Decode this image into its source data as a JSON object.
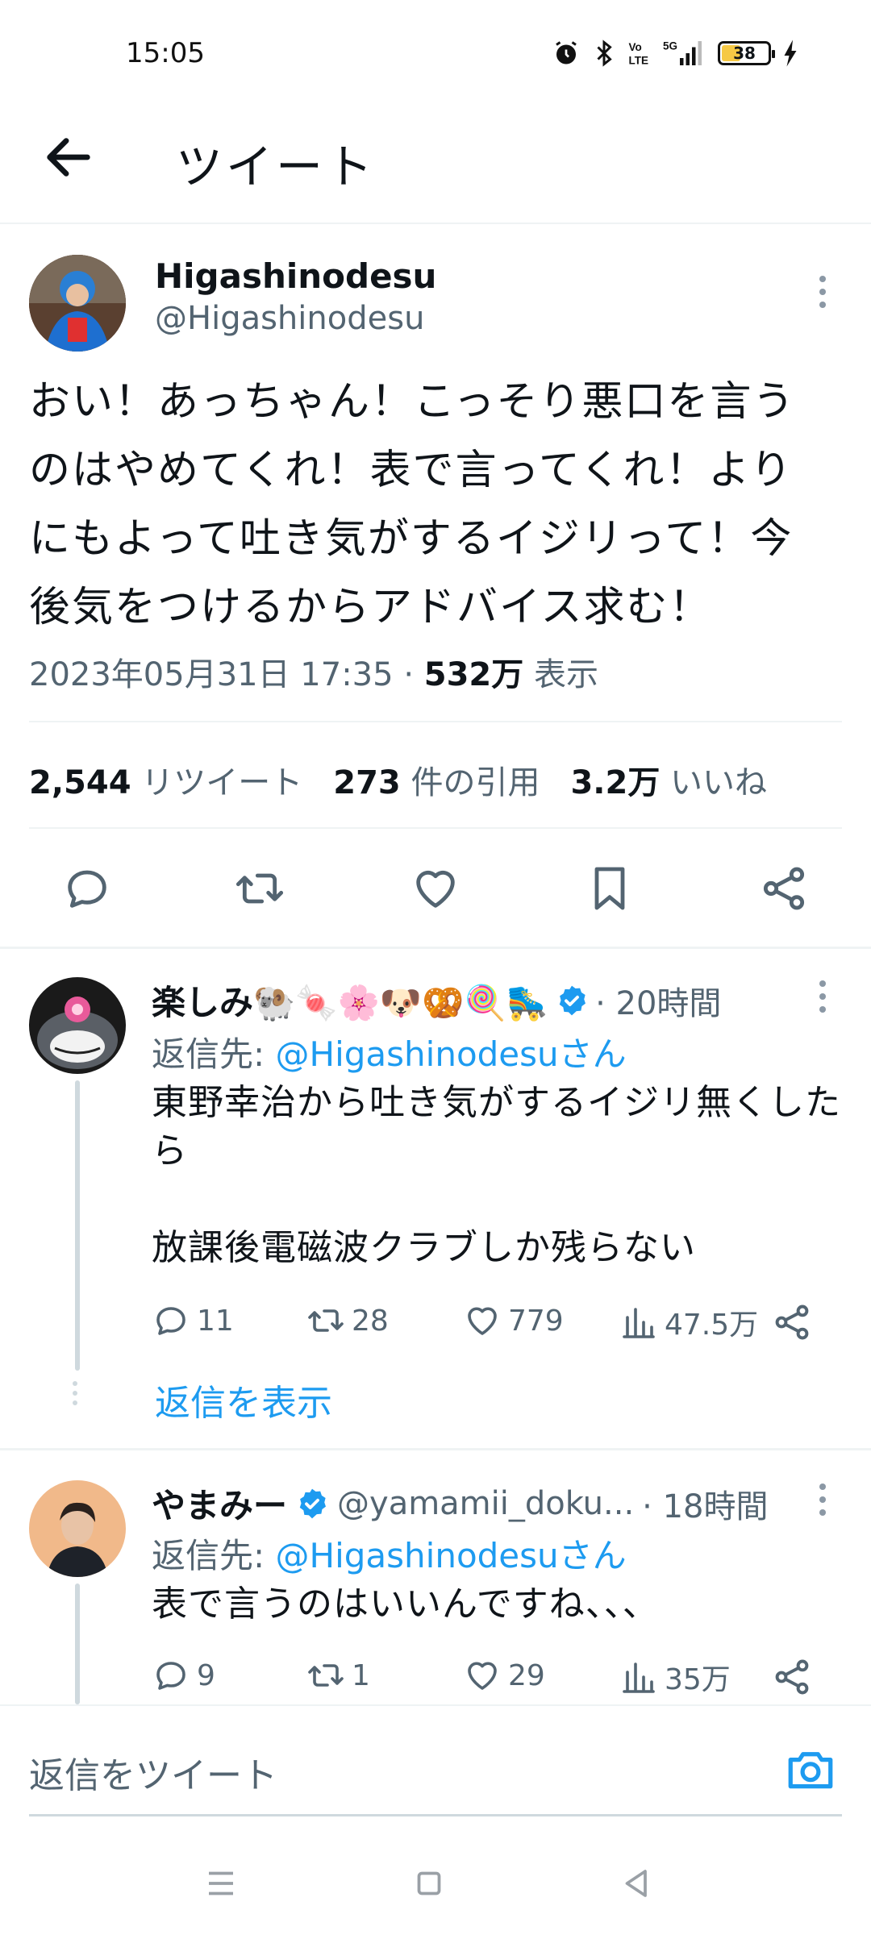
{
  "status_bar": {
    "time": "15:05",
    "battery": "38",
    "network": "5G",
    "icons": [
      "alarm-icon",
      "bluetooth-icon",
      "volte-icon",
      "signal-icon",
      "battery-icon",
      "charging-icon"
    ]
  },
  "header": {
    "title": "ツイート",
    "back_icon": "arrow-left-icon"
  },
  "tweet": {
    "author_name": "Higashinodesu",
    "author_handle": "@Higashinodesu",
    "text": "おい！あっちゃん！こっそり悪口を言う\nのはやめてくれ！表で言ってくれ！より\nにもよって吐き気がするイジリって！今\n後気をつけるからアドバイス求む！",
    "timestamp": "2023年05月31日 17:35",
    "separator": "·",
    "views_count": "532万",
    "views_label": "表示",
    "retweets_count": "2,544",
    "retweets_label": "リツイート",
    "quotes_count": "273",
    "quotes_label": "件の引用",
    "likes_count": "3.2万",
    "likes_label": "いいね"
  },
  "replies": [
    {
      "name": "楽しみ🐏🍬🌸🐶🥨🍭🛼",
      "verified": true,
      "time": "· 20時間",
      "reply_to_prefix": "返信先:",
      "reply_to_handle": "@Higashinodesuさん",
      "text": "東野幸治から吐き気がするイジリ無くした\nら\n\n放課後電磁波クラブしか残らない",
      "replies": "11",
      "retweets": "28",
      "likes": "779",
      "views": "47.5万",
      "show_replies": "返信を表示"
    },
    {
      "name": "やまみー",
      "verified": true,
      "handle": "@yamamii_doku...",
      "time": "· 18時間",
      "reply_to_prefix": "返信先:",
      "reply_to_handle": "@Higashinodesuさん",
      "text": "表で言うのはいいんですね、、、",
      "replies": "9",
      "retweets": "1",
      "likes": "29",
      "views": "35万"
    }
  ],
  "compose": {
    "placeholder": "返信をツイート"
  },
  "colors": {
    "accent": "#1d9bf0",
    "text": "#0f1419",
    "muted": "#536471",
    "border": "#eff3f4"
  }
}
